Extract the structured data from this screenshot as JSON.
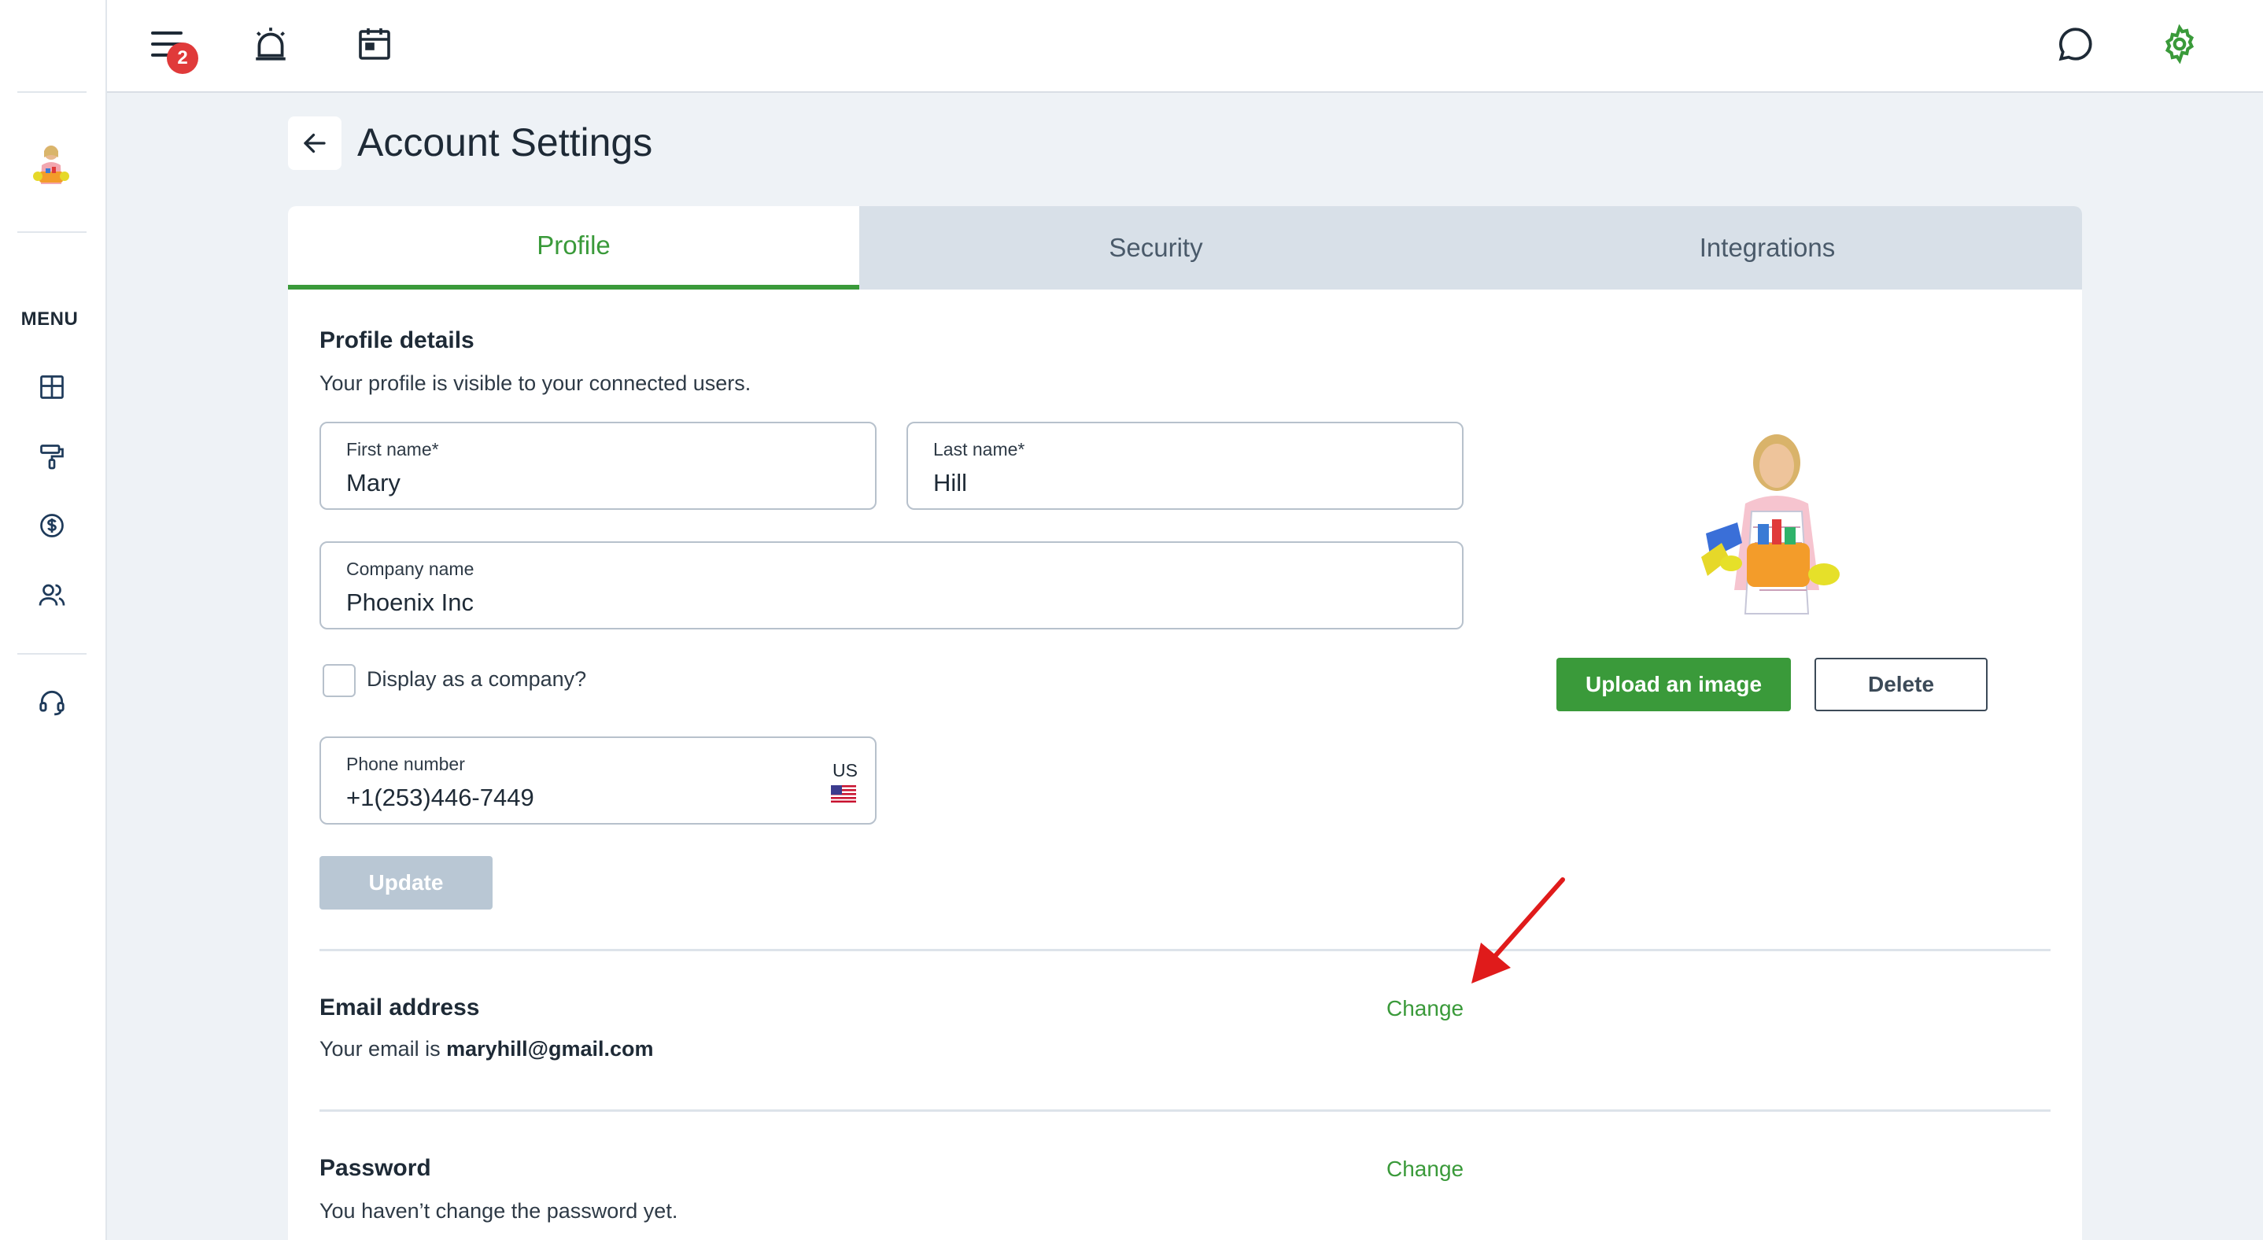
{
  "sidebar": {
    "menu_label": "MENU",
    "items": [
      {
        "icon": "dashboard-icon"
      },
      {
        "icon": "paint-roller-icon"
      },
      {
        "icon": "dollar-circle-icon"
      },
      {
        "icon": "users-icon"
      },
      {
        "icon": "headset-icon"
      }
    ]
  },
  "topbar": {
    "notification_count": "2"
  },
  "header": {
    "title": "Account Settings"
  },
  "tabs": [
    {
      "label": "Profile",
      "active": true
    },
    {
      "label": "Security",
      "active": false
    },
    {
      "label": "Integrations",
      "active": false
    }
  ],
  "profile": {
    "section_title": "Profile details",
    "section_sub": "Your profile is visible to your connected users.",
    "first_name_label": "First name*",
    "first_name_value": "Mary",
    "last_name_label": "Last name*",
    "last_name_value": "Hill",
    "company_label": "Company name",
    "company_value": "Phoenix Inc",
    "display_company_label": "Display as a company?",
    "phone_label": "Phone number",
    "phone_value": "+1(253)446-7449",
    "phone_country": "US",
    "update_label": "Update",
    "upload_label": "Upload an image",
    "delete_label": "Delete"
  },
  "email": {
    "title": "Email address",
    "prefix": "Your email is ",
    "address": "maryhill@gmail.com",
    "change_label": "Change"
  },
  "password": {
    "title": "Password",
    "sub": "You haven’t change the password yet.",
    "change_label": "Change"
  },
  "colors": {
    "accent": "#3a9a3a",
    "badge": "#e03a3a",
    "annotation_arrow": "#e01b1b"
  }
}
